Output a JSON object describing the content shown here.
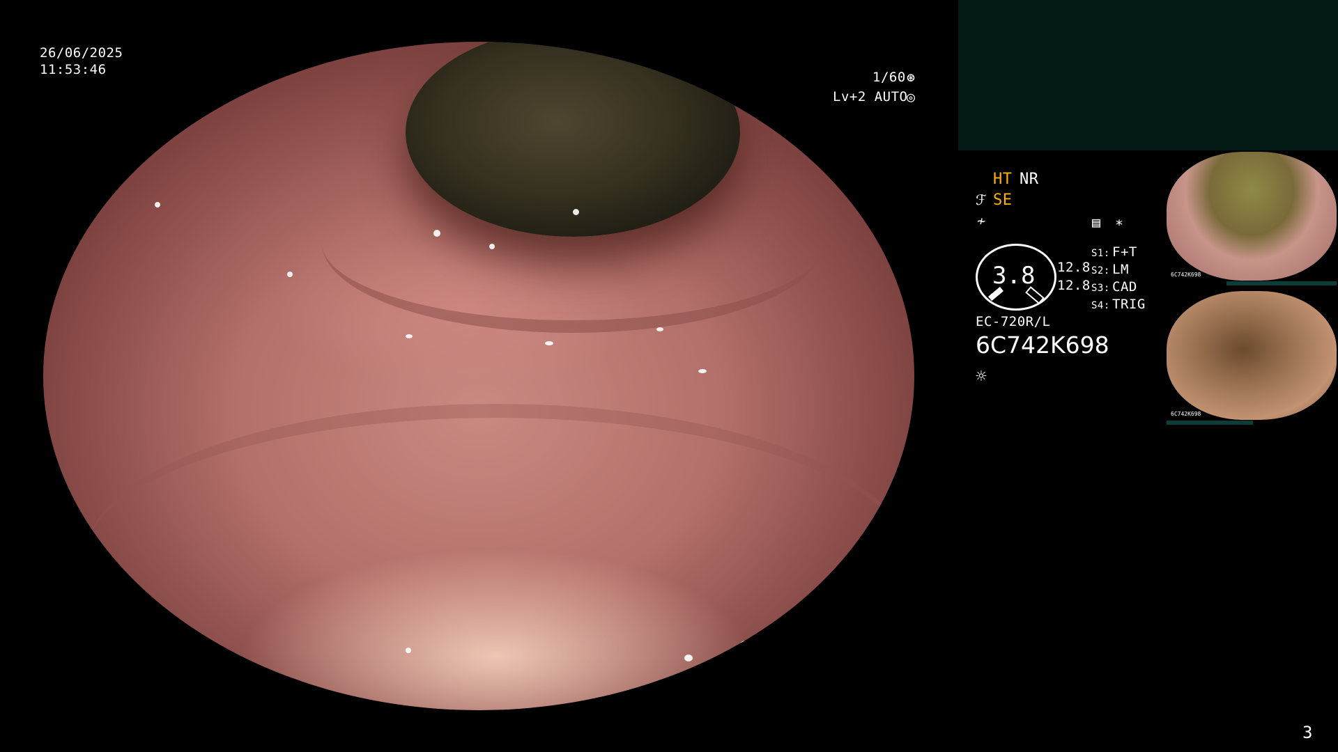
{
  "datetime": {
    "date": "26/06/2025",
    "time": "11:53:46"
  },
  "exposure": {
    "shutter": "1/60",
    "shutter_icon": "aperture-icon",
    "level": "Lv+2 AUTO",
    "level_icon": "target-icon"
  },
  "modes": {
    "ht": "HT",
    "nr": "NR",
    "se": "SE",
    "tilde": "≁",
    "asterisk": "∗"
  },
  "gauge": {
    "value": "3.8",
    "left_value": "12.8",
    "right_value": "12.8"
  },
  "switches": [
    {
      "key": "S1:",
      "value": "F+T"
    },
    {
      "key": "S2:",
      "value": "LM"
    },
    {
      "key": "S3:",
      "value": "CAD"
    },
    {
      "key": "S4:",
      "value": "TRIG"
    }
  ],
  "scope": {
    "model": "EC-720R/L",
    "serial": "6C742K698"
  },
  "page_number": "3",
  "thumbnails": [
    {
      "serial": "6C742K698"
    },
    {
      "serial": "6C742K698"
    }
  ],
  "colors": {
    "accent_orange": "#ffb100",
    "panel_dark": "#031a17"
  }
}
